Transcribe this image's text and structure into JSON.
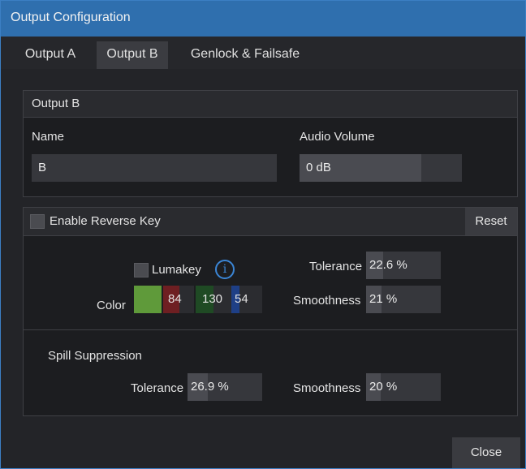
{
  "window": {
    "title": "Output Configuration"
  },
  "tabs": [
    {
      "label": "Output A"
    },
    {
      "label": "Output B"
    },
    {
      "label": "Genlock & Failsafe"
    }
  ],
  "output_section": {
    "title": "Output B",
    "name_label": "Name",
    "name_value": "B",
    "audio_label": "Audio Volume",
    "audio_value": "0 dB",
    "audio_level": 0.75
  },
  "reverse_key": {
    "enable_label": "Enable Reverse Key",
    "enabled": false,
    "reset_label": "Reset",
    "lumakey_label": "Lumakey",
    "lumakey_enabled": false,
    "info_glyph": "i",
    "color_label": "Color",
    "color_swatch": "#5f9a3a",
    "color_r": "84",
    "color_g": "130",
    "color_b": "54",
    "tolerance_label": "Tolerance",
    "tolerance_value": "22.6 %",
    "smoothness_label": "Smoothness",
    "smoothness_value": "21 %"
  },
  "spill": {
    "title": "Spill Suppression",
    "tolerance_label": "Tolerance",
    "tolerance_value": "26.9 %",
    "smoothness_label": "Smoothness",
    "smoothness_value": "20 %"
  },
  "footer": {
    "close_label": "Close"
  },
  "colors": {
    "accent": "#2f6fae",
    "red_channel": "#6e1f22",
    "green_channel": "#1f4a24",
    "blue_channel": "#1e3f86"
  }
}
